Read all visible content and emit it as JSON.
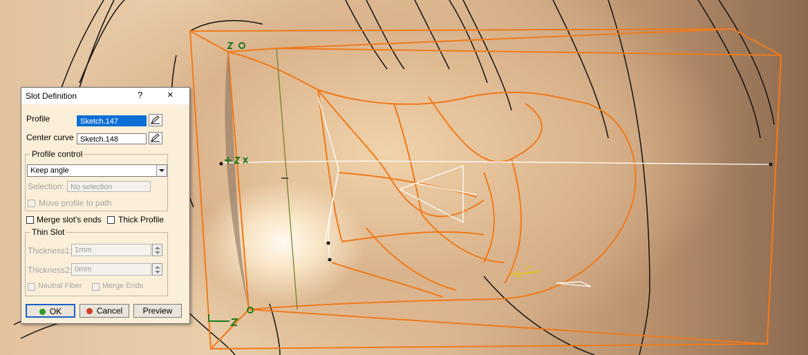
{
  "dialog": {
    "title": "Slot Definition",
    "help": "?",
    "close": "×",
    "profile_label": "Profile",
    "profile_value": "Sketch.147",
    "center_curve_label": "Center curve",
    "center_curve_value": "Sketch.148",
    "profile_control_legend": "Profile control",
    "profile_control_selected": "Keep angle",
    "selection_label": "Selection:",
    "selection_value": "No selection",
    "move_profile_label": "Move profile to path",
    "merge_ends_label": "Merge slot's ends",
    "thick_profile_label": "Thick Profile",
    "thin_slot_legend": "Thin Slot",
    "thickness1_label": "Thickness1:",
    "thickness1_value": "1mm",
    "thickness2_label": "Thickness2:",
    "thickness2_value": "0mm",
    "neutral_fiber_label": "Neutral Fiber",
    "merge_ends2_label": "Merge Ends",
    "ok_label": "OK",
    "cancel_label": "Cancel",
    "preview_label": "Preview"
  },
  "colors": {
    "wireframe": "#f07a1a",
    "ok_icon": "#2a9a2a",
    "cancel_icon": "#d43a2a"
  },
  "icons": {
    "ok": "green-dot-icon",
    "cancel": "red-dot-icon",
    "picker": "edit-pencil-icon",
    "compass": "axis-triad-icon"
  }
}
